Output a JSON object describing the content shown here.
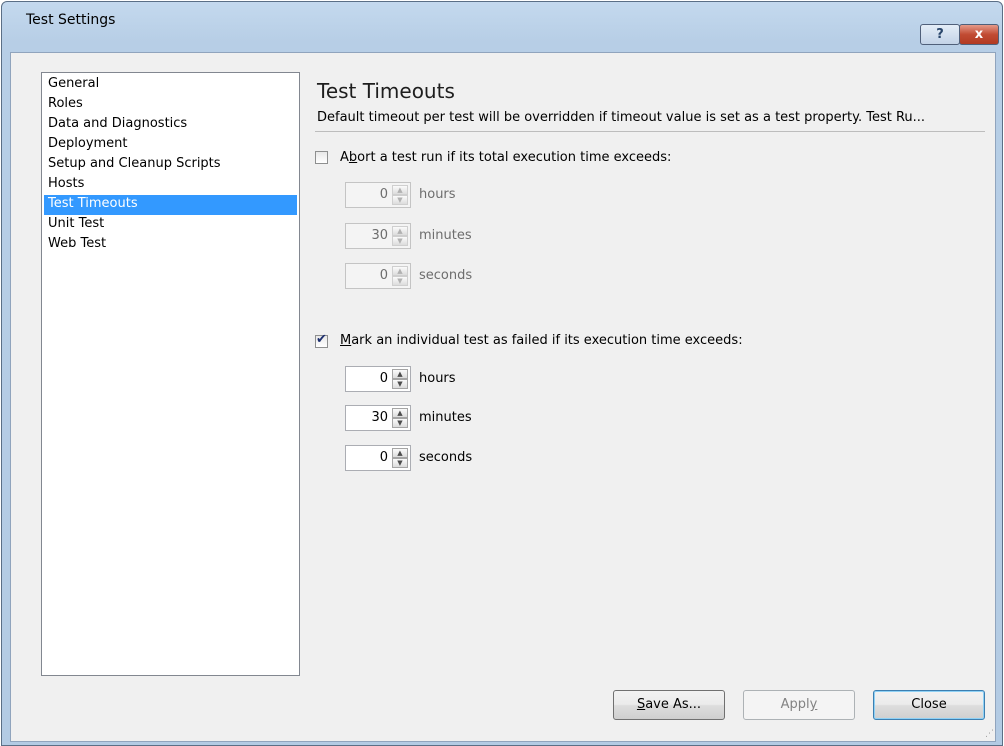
{
  "window": {
    "title": "Test Settings",
    "help_glyph": "?",
    "close_glyph": "x"
  },
  "nav": {
    "items": [
      {
        "label": "General"
      },
      {
        "label": "Roles"
      },
      {
        "label": "Data and Diagnostics"
      },
      {
        "label": "Deployment"
      },
      {
        "label": "Setup and Cleanup Scripts"
      },
      {
        "label": "Hosts"
      },
      {
        "label": "Test Timeouts",
        "selected": true
      },
      {
        "label": "Unit Test"
      },
      {
        "label": "Web Test"
      }
    ]
  },
  "panel": {
    "title": "Test Timeouts",
    "description": "Default timeout per test will be overridden if timeout value is set as a test property. Test Ru...",
    "abort": {
      "checked": false,
      "label_pre": "A",
      "label_mnemonic": "b",
      "label_post": "ort a test run if its total execution time exceeds:",
      "hours": "0",
      "minutes": "30",
      "seconds": "0",
      "hours_unit": "hours",
      "minutes_unit": "minutes",
      "seconds_unit": "seconds"
    },
    "mark_failed": {
      "checked": true,
      "label_mnemonic": "M",
      "label_post": "ark an individual test as failed if its execution time exceeds:",
      "hours": "0",
      "minutes": "30",
      "seconds": "0",
      "hours_unit": "hours",
      "minutes_unit": "minutes",
      "seconds_unit": "seconds"
    }
  },
  "buttons": {
    "save_as_mnemonic": "S",
    "save_as_rest": "ave As...",
    "apply_pre": "Appl",
    "apply_mnemonic": "y",
    "close": "Close"
  },
  "glyphs": {
    "check": "✔",
    "spin_up": "▲",
    "spin_down": "▼",
    "grip": "⋰"
  },
  "colors": {
    "selection": "#3399ff",
    "title_bar": "#b9d1ea",
    "close_button": "#c14b33"
  }
}
